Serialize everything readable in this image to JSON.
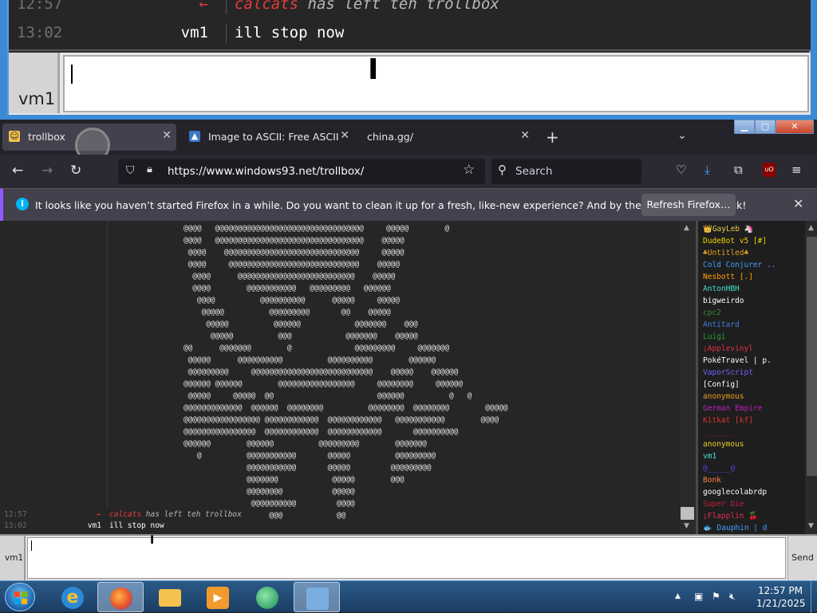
{
  "zoom": {
    "lines": [
      {
        "time": "12:57",
        "nick": "←",
        "nick_color": "#e63b3b",
        "msg_nick": "calcats",
        "msg": " has left teh trollbox"
      },
      {
        "time": "13:02",
        "nick": "vm1",
        "nick_color": "#ffffff",
        "msg": "ill stop now"
      }
    ],
    "input_nick": "vm1"
  },
  "browser": {
    "tabs": [
      {
        "label": "trollbox",
        "icon": "trollbox-favicon",
        "active": true
      },
      {
        "label": "Image to ASCII: Free ASCII Art C",
        "icon": "ascii-favicon",
        "active": false
      },
      {
        "label": "china.gg/",
        "icon": "",
        "active": false
      }
    ],
    "url": "https://www.windows93.net/trollbox/",
    "search_placeholder": "Search",
    "toolbar_icons": [
      "pocket-icon",
      "downloads-icon",
      "extensions-icon",
      "ublock-icon",
      "menu-icon"
    ],
    "ublock_label": "uO"
  },
  "notification": {
    "text": "It looks like you haven’t started Firefox in a while. Do you want to clean it up for a fresh, like-new experience? And by the way, welcome back!",
    "button": "Refresh Firefox…"
  },
  "trollbox": {
    "ascii_art": "@@@@   @@@@@@@@@@@@@@@@@@@@@@@@@@@@@@@@@     @@@@@        @\n@@@@   @@@@@@@@@@@@@@@@@@@@@@@@@@@@@@@@@    @@@@@\n @@@@    @@@@@@@@@@@@@@@@@@@@@@@@@@@@@@     @@@@@\n @@@@     @@@@@@@@@@@@@@@@@@@@@@@@@@@@@    @@@@@\n  @@@@      @@@@@@@@@@@@@@@@@@@@@@@@@@    @@@@@\n  @@@@        @@@@@@@@@@@   @@@@@@@@@   @@@@@@\n   @@@@          @@@@@@@@@@      @@@@@     @@@@@\n    @@@@@          @@@@@@@@@       @@    @@@@@\n     @@@@@          @@@@@@            @@@@@@@    @@@\n      @@@@@          @@@            @@@@@@@    @@@@@\n@@      @@@@@@@        @              @@@@@@@@@     @@@@@@@\n @@@@@      @@@@@@@@@@          @@@@@@@@@@        @@@@@@\n @@@@@@@@@     @@@@@@@@@@@@@@@@@@@@@@@@@@@    @@@@@    @@@@@@\n@@@@@@ @@@@@@        @@@@@@@@@@@@@@@@@     @@@@@@@@     @@@@@@\n @@@@@     @@@@@  @@                       @@@@@@          @   @\n@@@@@@@@@@@@@  @@@@@@  @@@@@@@@          @@@@@@@@  @@@@@@@@        @@@@@\n@@@@@@@@@@@@@@@@@ @@@@@@@@@@@@  @@@@@@@@@@@@   @@@@@@@@@@@        @@@@\n@@@@@@@@@@@@@@@@  @@@@@@@@@@@@  @@@@@@@@@@@@       @@@@@@@@@@\n@@@@@@        @@@@@@          @@@@@@@@@        @@@@@@@\n   @          @@@@@@@@@@@       @@@@@          @@@@@@@@@\n              @@@@@@@@@@@       @@@@@         @@@@@@@@@\n              @@@@@@@            @@@@@        @@@\n              @@@@@@@@           @@@@@\n               @@@@@@@@@@         @@@@\n                   @@@            @@",
    "messages": [
      {
        "time": "12:57",
        "nick": "←",
        "nick_color": "#e63b3b",
        "msg_nick": "calcats",
        "msg": " has left teh trollbox"
      },
      {
        "time": "13:02",
        "nick": "vm1",
        "nick_color": "#ffffff",
        "msg": "ill stop now"
      }
    ],
    "users": [
      {
        "name": "👑GayLeb 🦄",
        "color": "#e6c84a"
      },
      {
        "name": "DudeBot v5 [#]",
        "color": "#f0d000"
      },
      {
        "name": "♣Untitled♣",
        "color": "#e8a020"
      },
      {
        "name": "Cold Conjurer ..",
        "color": "#3fa0ff"
      },
      {
        "name": "Nesbott [.]",
        "color": "#ffa000"
      },
      {
        "name": "AntonHBH",
        "color": "#40e0d0"
      },
      {
        "name": "bigweirdo",
        "color": "#ffffff"
      },
      {
        "name": "cpc2",
        "color": "#3a8a3a"
      },
      {
        "name": "Antitard",
        "color": "#3f7fe0"
      },
      {
        "name": "Luigi",
        "color": "#2aa02a"
      },
      {
        "name": "¡Applevinyl",
        "color": "#e0304a"
      },
      {
        "name": "PokéTravel | p.",
        "color": "#ffffff"
      },
      {
        "name": "VaporScript",
        "color": "#7060ff"
      },
      {
        "name": "[Config]",
        "color": "#ffffff"
      },
      {
        "name": "anonymous",
        "color": "#e8a020"
      },
      {
        "name": "German Empire",
        "color": "#c020c0"
      },
      {
        "name": "Kitkat [kf]",
        "color": "#e03030"
      },
      {
        "name": "_______",
        "color": "#a01010"
      },
      {
        "name": "anonymous",
        "color": "#e8d020"
      },
      {
        "name": "vm1",
        "color": "#40e0e0"
      },
      {
        "name": "@_____@",
        "color": "#6040e0"
      },
      {
        "name": "Bonk",
        "color": "#ff8040"
      },
      {
        "name": "googlecolabrdp",
        "color": "#ffffff"
      },
      {
        "name": "Super Die",
        "color": "#c02040"
      },
      {
        "name": "¡Flapplin 🍒",
        "color": "#e03050"
      },
      {
        "name": "🐟 Dauphin | d",
        "color": "#40a0ff"
      }
    ],
    "input_nick": "vm1",
    "send_label": "Send"
  },
  "taskbar": {
    "clock_time": "12:57 PM",
    "clock_date": "1/21/2025",
    "pinned": [
      "ie-icon",
      "firefox-icon",
      "explorer-icon",
      "media-player-icon",
      "network-app-icon",
      "control-panel-icon"
    ]
  }
}
